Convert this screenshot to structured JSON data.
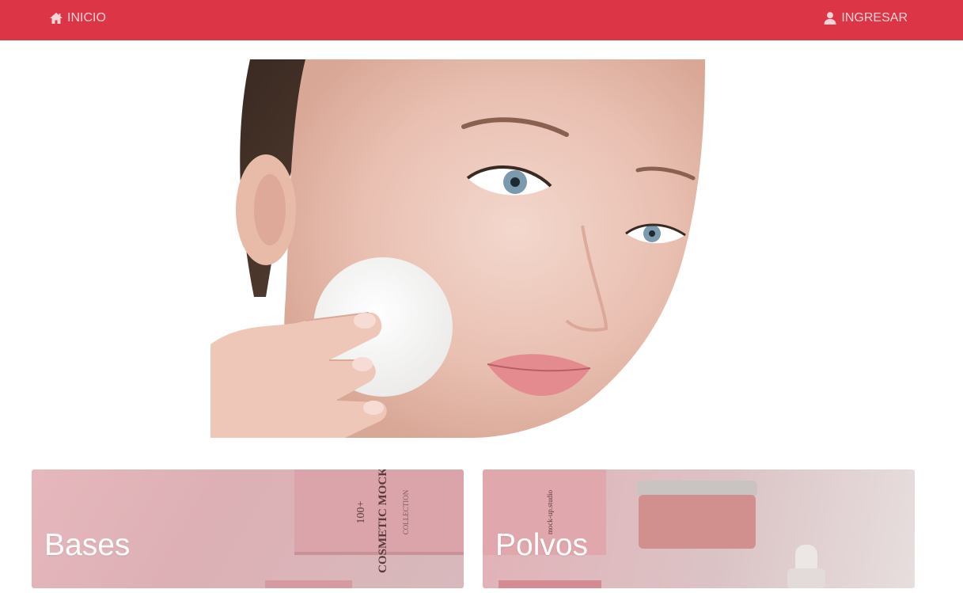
{
  "nav": {
    "home_label": "INICIO",
    "home_icon": "home-icon",
    "login_label": "INGRESAR",
    "login_icon": "user-icon"
  },
  "colors": {
    "navbar": "#dc3545",
    "nav_text": "#f6d3d7",
    "card_text": "#ffffff"
  },
  "categories": [
    {
      "title": "Bases",
      "box_text_1": "100+",
      "box_text_2": "COSMETIC MOCKUP",
      "box_text_3": "COLLECTION"
    },
    {
      "title": "Polvos",
      "box_text_1": "mock-up.studio"
    }
  ]
}
